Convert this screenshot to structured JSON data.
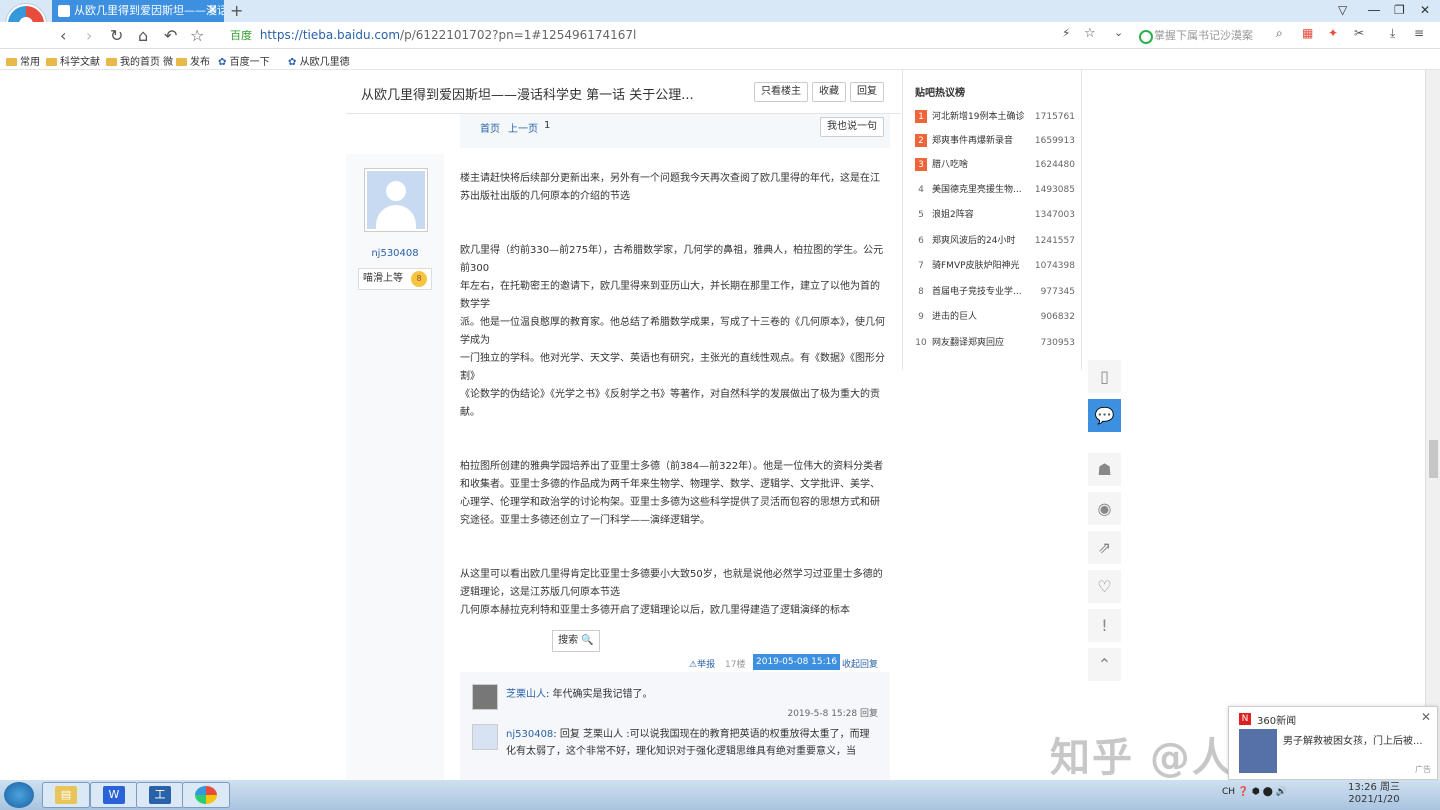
{
  "browser": {
    "tab_title": "从欧几里得到爱因斯坦——漫话",
    "tab_close": "✕",
    "new_tab": "+",
    "address_secure": "百度",
    "url_main": "https://tieba.baidu.com",
    "url_rest": "/p/6122101702?pn=1#125496174167l",
    "search_placeholder": "掌握下属书记沙漠案"
  },
  "bookmarks": [
    "常用",
    "科学文献",
    "我的首页 微",
    "发布",
    "百度一下",
    "从欧几里德"
  ],
  "post": {
    "title": "从欧几里得到爱因斯坦——漫话科学史 第一话 关于公理...",
    "btn_only_op": "只看楼主",
    "btn_collect": "收藏",
    "btn_reply": "回复",
    "pager_first": "首页",
    "pager_prev": "上一页",
    "pager_num": "1",
    "btn_say": "我也说一句",
    "username": "nj530408",
    "user_level_label": "喵滑上等",
    "user_level_num": "8",
    "paragraphs": [
      "楼主请赶快将后续部分更新出来，另外有一个问题我今天再次查阅了欧几里得的年代，这是在江苏出版社出版的几何原本的介绍的节选",
      "",
      "欧几里得（约前330—前275年），古希腊数学家，几何学的鼻祖，雅典人，柏拉图的学生。公元前300",
      "年左右，在托勒密王的邀请下，欧几里得来到亚历山大，并长期在那里工作，建立了以他为首的数学学",
      "派。他是一位温良憨厚的教育家。他总结了希腊数学成果，写成了十三卷的《几何原本》，使几何学成为",
      "一门独立的学科。他对光学、天文学、英语也有研究，主张光的直线性观点。有《数据》《图形分割》",
      "《论数学的伪结论》《光学之书》《反射学之书》等著作，对自然科学的发展做出了极为重大的贡献。",
      "",
      "",
      "柏拉图所创建的雅典学园培养出了亚里士多德（前384—前322年）。他是一位伟大的资料分类者和收集者。亚里士多德的作品成为两千年来生物学、物理学、数学、逻辑学、文学批评、美学、心理学、伦理学和政治学的讨论构架。亚里士多德为这些科学提供了灵活而包容的思想方式和研究途径。亚里士多德还创立了一门科学——演绎逻辑学。",
      "",
      "",
      "从这里可以看出欧几里得肯定比亚里士多德要小大致50岁，也就是说他必然学习过亚里士多德的逻辑理论，这是江苏版几何原本节选",
      "几何原本赫拉克利特和亚里士多德开启了逻辑理论以后，欧几里得建造了逻辑演绎的标本"
    ],
    "search_popup": "搜索 🔍",
    "report": "⚠举报",
    "floor": "17楼",
    "datetime": "2019-05-08 15:16",
    "collapse": "收起回复"
  },
  "replies": [
    {
      "name": "芝栗山人",
      "text": ": 年代确实是我记错了。",
      "time": "2019-5-8 15:28 回复"
    },
    {
      "name": "nj530408",
      "text": ": 回复 芝栗山人 :可以说我国现在的教育把英语的权重放得太重了，而理化有太弱了，这个非常不好，理化知识对于强化逻辑思维具有绝对重要意义，当"
    }
  ],
  "sidebar": {
    "title": "贴吧热议榜",
    "items": [
      {
        "rank": "1",
        "name": "河北新增19例本土确诊",
        "count": "1715761"
      },
      {
        "rank": "2",
        "name": "郑爽事件再爆新录音",
        "count": "1659913"
      },
      {
        "rank": "3",
        "name": "腊八吃啥",
        "count": "1624480"
      },
      {
        "rank": "4",
        "name": "美国德克里亮援生物...",
        "count": "1493085"
      },
      {
        "rank": "5",
        "name": "浪姐2阵容",
        "count": "1347003"
      },
      {
        "rank": "6",
        "name": "郑爽风波后的24小时",
        "count": "1241557"
      },
      {
        "rank": "7",
        "name": "骑FMVP皮肤炉阳神光",
        "count": "1074398"
      },
      {
        "rank": "8",
        "name": "首届电子竞技专业学...",
        "count": "977345"
      },
      {
        "rank": "9",
        "name": "进击的巨人",
        "count": "906832"
      },
      {
        "rank": "10",
        "name": "网友翻译郑爽回应",
        "count": "730953"
      }
    ]
  },
  "news": {
    "title": "360新闻",
    "text": "男子解救被困女孩，门上后被...",
    "ad": "广告",
    "close": "✕"
  },
  "watermark": "知乎 @人性的游戏",
  "taskbar": {
    "tray": "CH ❓ ⬢ ⬤ 🔊",
    "time": "13:26 周三",
    "date": "2021/1/20"
  },
  "colors": {
    "accent": "#3d8fe0",
    "link": "#2a62a8",
    "hot_rank": "#f0643a"
  }
}
